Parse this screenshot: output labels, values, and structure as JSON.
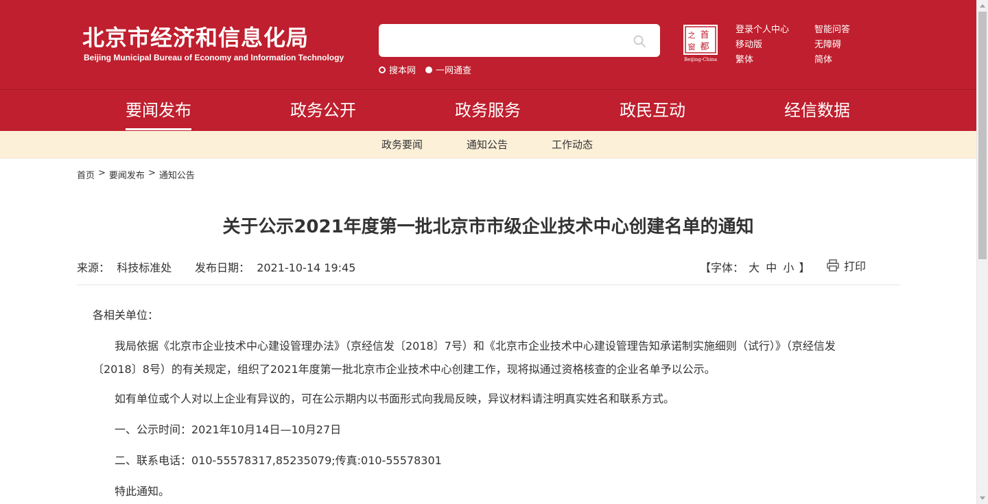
{
  "header": {
    "title_cn": "北京市经济和信息化局",
    "title_en": "Beijing Municipal Bureau of Economy and Information Technology",
    "search_placeholder": "",
    "radios": [
      {
        "label": "搜本网",
        "selected": false
      },
      {
        "label": "一网通查",
        "selected": true
      }
    ],
    "seal": {
      "chars": [
        "首",
        "都",
        "之",
        "窗"
      ],
      "caption": "Beijing-China"
    },
    "links_col1": [
      "登录个人中心",
      "移动版",
      "繁体"
    ],
    "links_col2": [
      "智能问答",
      "无障碍",
      "简体"
    ]
  },
  "nav": {
    "items": [
      "要闻发布",
      "政务公开",
      "政务服务",
      "政民互动",
      "经信数据"
    ],
    "active": "要闻发布"
  },
  "subnav": {
    "items": [
      "政务要闻",
      "通知公告",
      "工作动态"
    ]
  },
  "breadcrumb": {
    "items": [
      "首页",
      "要闻发布",
      "通知公告"
    ],
    "separator": ">"
  },
  "article": {
    "title": "关于公示2021年度第一批北京市市级企业技术中心创建名单的通知",
    "source_label": "来源：",
    "source": "科技标准处",
    "date_label": "发布日期：",
    "date": "2021-10-14 19:45",
    "font_label_open": "【字体：",
    "font_sizes": [
      "大",
      "中",
      "小"
    ],
    "font_label_close": "】",
    "print_label": "打印",
    "paragraphs": [
      "各相关单位：",
      "我局依据《北京市企业技术中心建设管理办法》（京经信发〔2018〕7号）和《北京市企业技术中心建设管理告知承诺制实施细则（试行）》（京经信发〔2018〕8号）的有关规定，组织了2021年度第一批北京市企业技术中心创建工作，现将拟通过资格核查的企业名单予以公示。",
      "如有单位或个人对以上企业有异议的，可在公示期内以书面形式向我局反映，异议材料请注明真实姓名和联系方式。",
      "一、公示时间：2021年10月14日—10月27日",
      "二、联系电话：010-55578317,85235079;传真:010-55578301",
      "特此通知。"
    ]
  },
  "colors": {
    "brand_red": "#bf1f2e",
    "subnav_bg": "#fdf0d9"
  }
}
